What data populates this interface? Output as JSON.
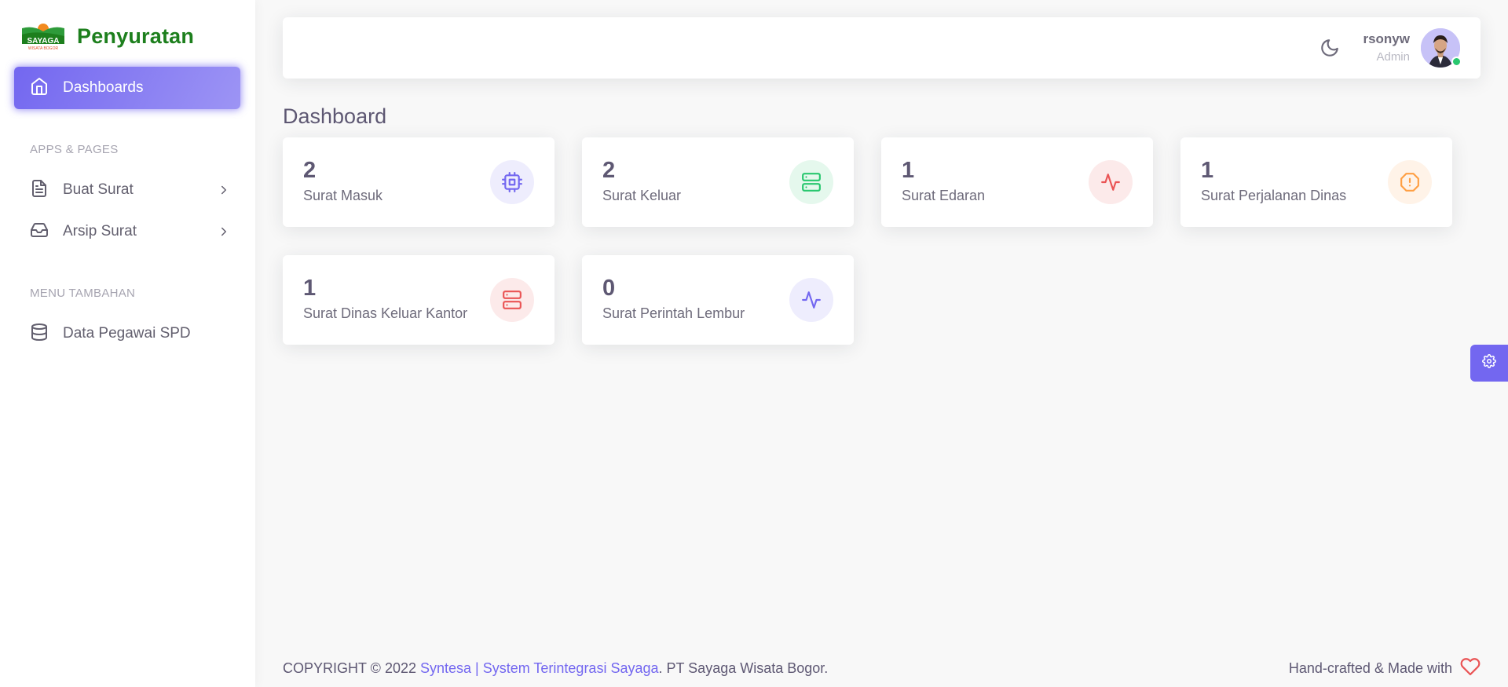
{
  "sidebar": {
    "brand": "Penyuratan",
    "logo_text": "SAYAGA",
    "logo_subtext": "WISATA BOGOR",
    "active_item": {
      "label": "Dashboards",
      "icon": "home-icon"
    },
    "sections": [
      {
        "header": "APPS & PAGES"
      },
      {
        "header": "MENU TAMBAHAN"
      }
    ],
    "items": [
      {
        "label": "Buat Surat",
        "icon": "file-text-icon"
      },
      {
        "label": "Arsip Surat",
        "icon": "inbox-icon"
      },
      {
        "label": "Data Pegawai SPD",
        "icon": "database-icon"
      }
    ]
  },
  "navbar": {
    "user_name": "rsonyw",
    "user_role": "Admin",
    "theme_icon": "moon-icon"
  },
  "page": {
    "title": "Dashboard"
  },
  "cards": [
    {
      "value": "2",
      "label": "Surat Masuk",
      "icon": "cpu-icon",
      "color": "#7367f0"
    },
    {
      "value": "2",
      "label": "Surat Keluar",
      "icon": "server-icon",
      "color": "#28c76f"
    },
    {
      "value": "1",
      "label": "Surat Edaran",
      "icon": "activity-icon",
      "color": "#ea5455"
    },
    {
      "value": "1",
      "label": "Surat Perjalanan Dinas",
      "icon": "alert-octagon-icon",
      "color": "#ff9f43"
    },
    {
      "value": "1",
      "label": "Surat Dinas Keluar Kantor",
      "icon": "server-icon",
      "color": "#ea5455"
    },
    {
      "value": "0",
      "label": "Surat Perintah Lembur",
      "icon": "activity-icon",
      "color": "#7367f0"
    }
  ],
  "footer": {
    "copyright_prefix": "COPYRIGHT © 2022 ",
    "link_text": "Syntesa | System Terintegrasi Sayaga",
    "copyright_suffix": ". PT Sayaga Wisata Bogor.",
    "made_with": "Hand-crafted & Made with",
    "heart_icon": "heart-icon",
    "heart_color": "#ea5455"
  },
  "colors": {
    "primary": "#7367f0",
    "success": "#28c76f",
    "danger": "#ea5455",
    "warning": "#ff9f43",
    "brand_green": "#1d7f1d"
  }
}
